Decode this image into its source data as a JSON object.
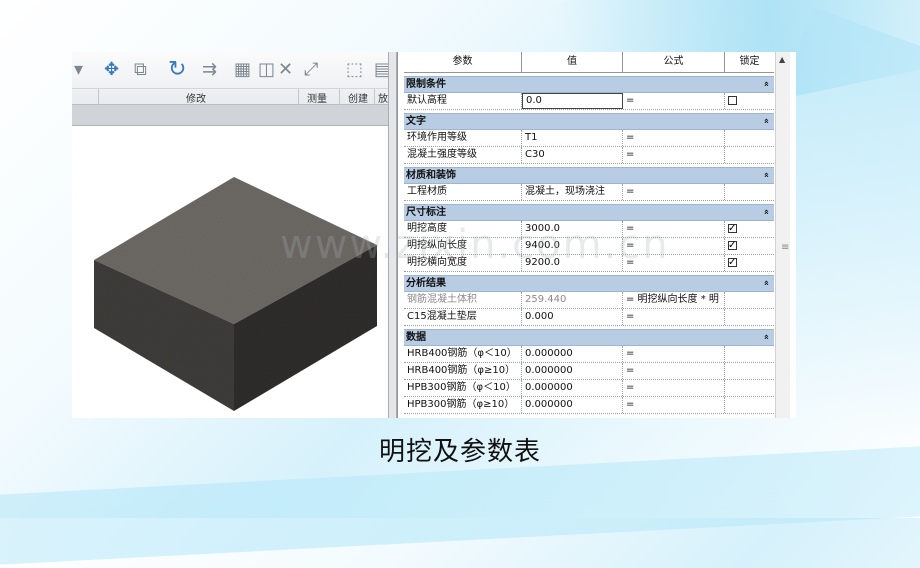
{
  "caption": "明挖及参数表",
  "watermark": "www.zixin.com.cn",
  "ribbon": {
    "groups": [
      {
        "label": "修改"
      },
      {
        "label": "测量"
      },
      {
        "label": "创建"
      },
      {
        "label": "放"
      }
    ],
    "icons": [
      "move-icon",
      "copy-icon",
      "rotate-icon",
      "align-icon",
      "array-icon",
      "scale-icon",
      "delete-icon",
      "measure-icon",
      "create-group-icon"
    ]
  },
  "model": {
    "name": "concrete-block",
    "colors": {
      "top": "#6e6a66",
      "left": "#3f3d3b",
      "right": "#2f2e2d"
    }
  },
  "table": {
    "headers": {
      "param": "参数",
      "value": "值",
      "formula": "公式",
      "lock": "锁定"
    },
    "sections": [
      {
        "title": "限制条件",
        "collapse": "»",
        "rows": [
          {
            "name": "默认高程",
            "value": "0.0",
            "formula": "=",
            "lock": "unchecked",
            "focus": true
          }
        ]
      },
      {
        "title": "文字",
        "collapse": "»",
        "rows": [
          {
            "name": "环境作用等级",
            "value": "T1",
            "formula": "=",
            "lock": "none"
          },
          {
            "name": "混凝土强度等级",
            "value": "C30",
            "formula": "=",
            "lock": "none"
          }
        ]
      },
      {
        "title": "材质和装饰",
        "collapse": "»",
        "rows": [
          {
            "name": "工程材质",
            "value": "混凝土，现场浇注",
            "formula": "=",
            "lock": "none"
          }
        ]
      },
      {
        "title": "尺寸标注",
        "collapse": "»",
        "rows": [
          {
            "name": "明挖高度",
            "value": "3000.0",
            "formula": "=",
            "lock": "checked"
          },
          {
            "name": "明挖纵向长度",
            "value": "9400.0",
            "formula": "=",
            "lock": "checked"
          },
          {
            "name": "明挖横向宽度",
            "value": "9200.0",
            "formula": "=",
            "lock": "checked"
          }
        ]
      },
      {
        "title": "分析结果",
        "collapse": "»",
        "rows": [
          {
            "name": "钢筋混凝土体积",
            "value": "259.440",
            "formula": "= 明挖纵向长度 * 明",
            "lock": "none",
            "gray": true
          },
          {
            "name": "C15混凝土垫层",
            "value": "0.000",
            "formula": "=",
            "lock": "none"
          }
        ]
      },
      {
        "title": "数据",
        "collapse": "»",
        "rows": [
          {
            "name": "HRB400钢筋（φ＜10）",
            "value": "0.000000",
            "formula": "=",
            "lock": "none"
          },
          {
            "name": "HRB400钢筋（φ≥10）",
            "value": "0.000000",
            "formula": "=",
            "lock": "none"
          },
          {
            "name": "HPB300钢筋（φ＜10）",
            "value": "0.000000",
            "formula": "=",
            "lock": "none"
          },
          {
            "name": "HPB300钢筋（φ≥10）",
            "value": "0.000000",
            "formula": "=",
            "lock": "none"
          }
        ]
      }
    ]
  }
}
